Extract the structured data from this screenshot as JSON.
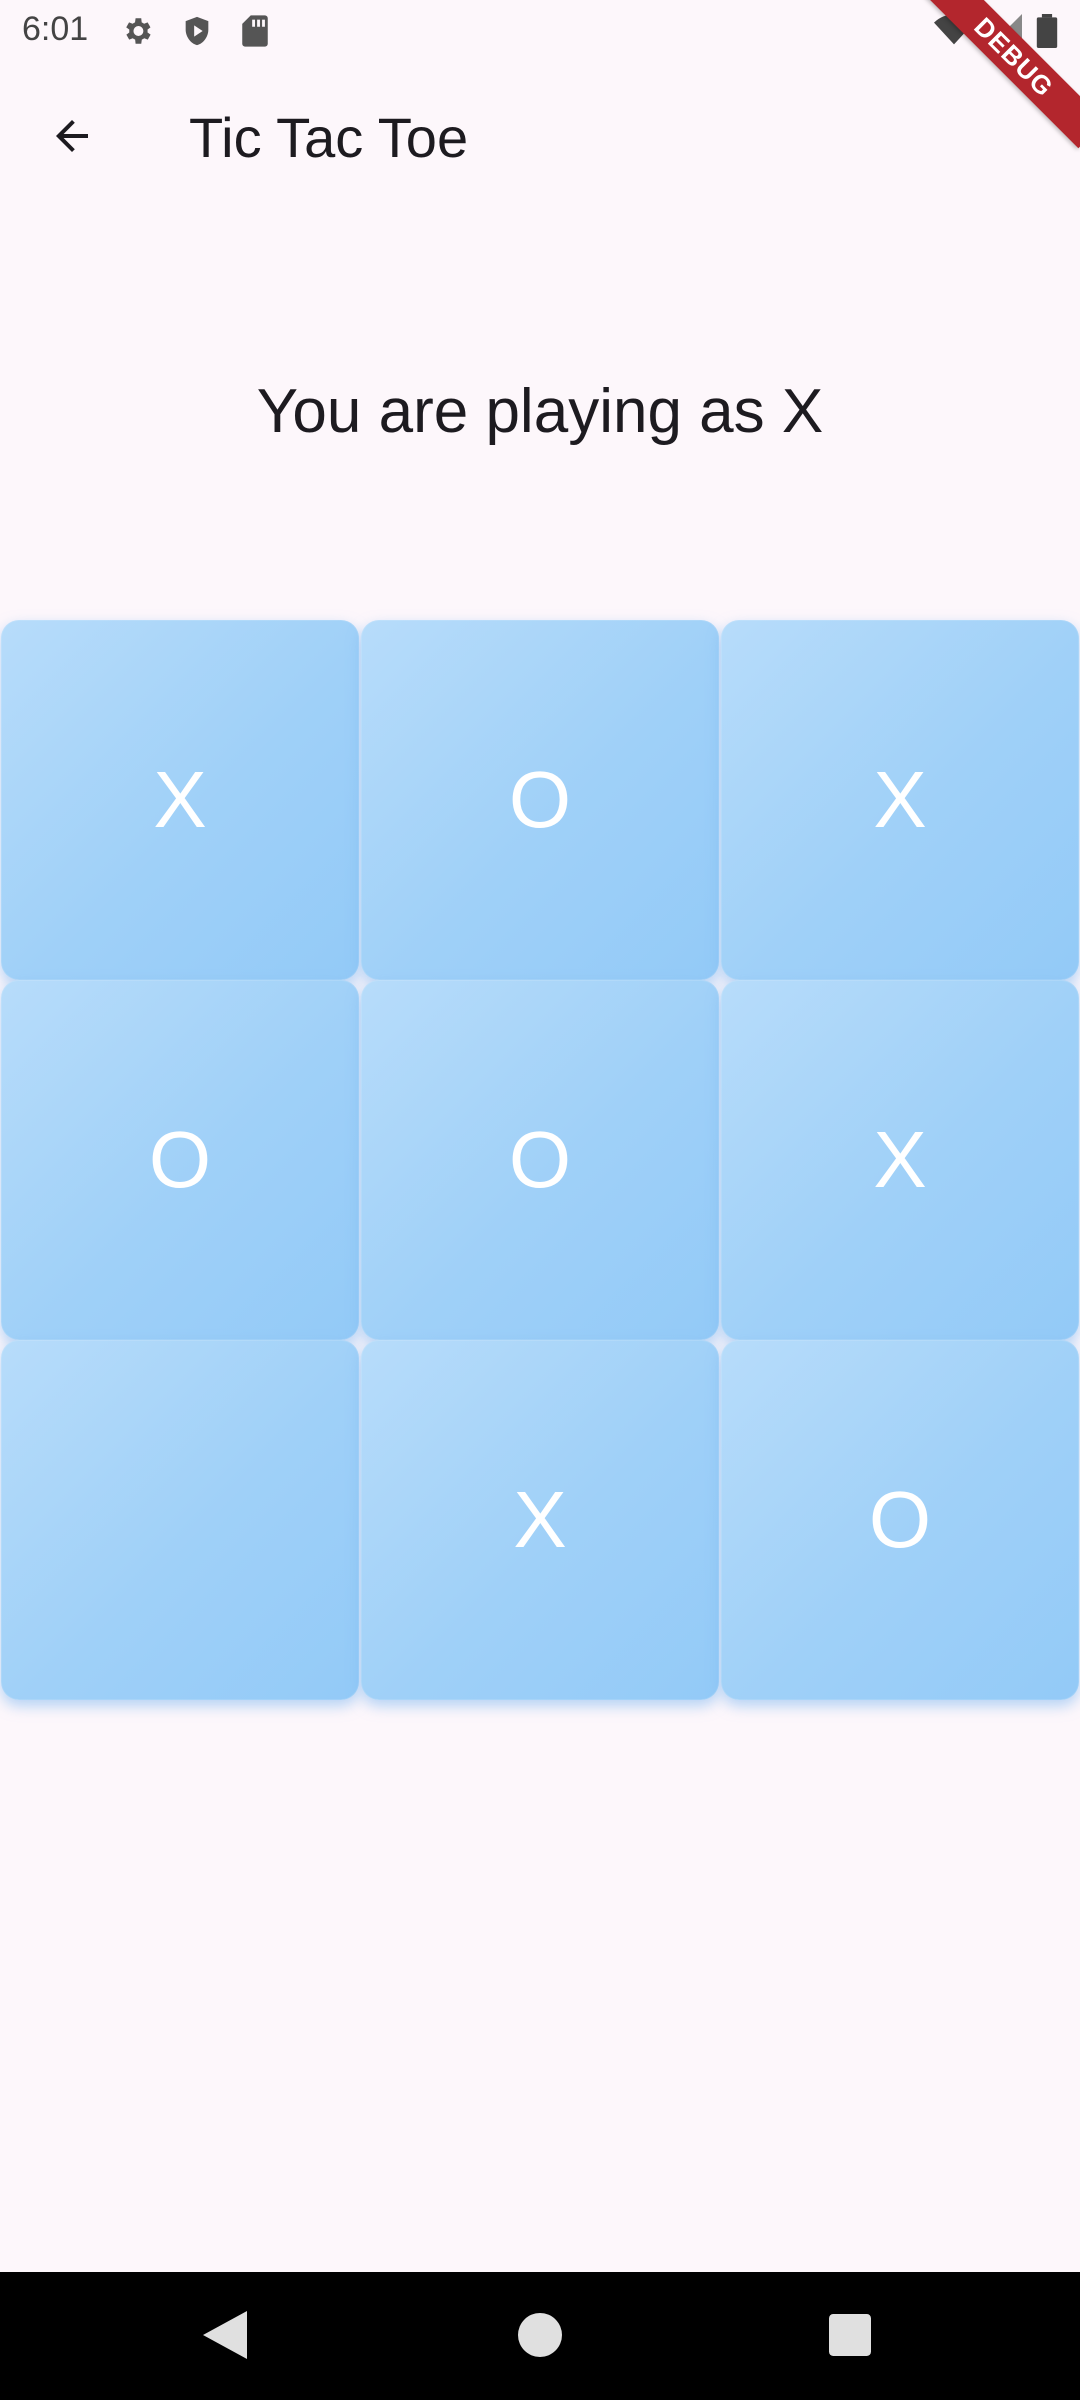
{
  "status_bar": {
    "time": "6:01",
    "icons_left": [
      "gear-icon",
      "shield-play-icon",
      "sd-card-icon"
    ],
    "icons_right": [
      "wifi-icon",
      "signal-icon",
      "battery-icon"
    ]
  },
  "debug_banner": {
    "label": "DEBUG"
  },
  "app_bar": {
    "title": "Tic Tac Toe",
    "back_icon": "arrow-back-icon"
  },
  "game": {
    "message": "You are playing as X",
    "board": [
      "X",
      "O",
      "X",
      "O",
      "O",
      "X",
      "",
      "X",
      "O"
    ]
  },
  "nav_bar": {
    "buttons": [
      "back-triangle-icon",
      "home-circle-icon",
      "recents-square-icon"
    ]
  },
  "colors": {
    "background": "#fdf7fb",
    "cell": "#a6d4f9",
    "mark": "#ffffff",
    "debug": "#b3262d"
  }
}
